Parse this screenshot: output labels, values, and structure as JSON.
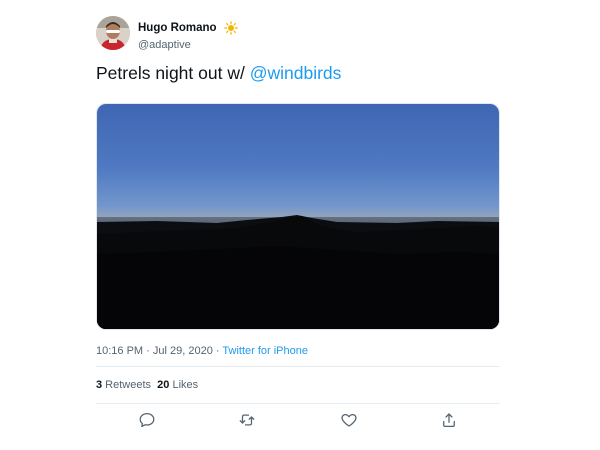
{
  "author": {
    "display_name": "Hugo Romano",
    "handle": "@adaptive",
    "badge_icon": "sun-icon",
    "badge_color": "#f5b400"
  },
  "tweet": {
    "text_main": "Petrels night out w/ ",
    "mention": "@windbirds",
    "mention_color": "#1d9bf0"
  },
  "media": {
    "description_icon": "sunset-photo"
  },
  "meta": {
    "time": "10:16 PM",
    "separator1": " · ",
    "date": "Jul 29, 2020",
    "separator2": " · ",
    "source": "Twitter for iPhone"
  },
  "stats": {
    "retweets_count": "3",
    "retweets_label": " Retweets",
    "likes_count": "20",
    "likes_label": " Likes"
  },
  "actions": {
    "reply": "reply-icon",
    "retweet": "retweet-icon",
    "like": "heart-icon",
    "share": "share-icon"
  }
}
